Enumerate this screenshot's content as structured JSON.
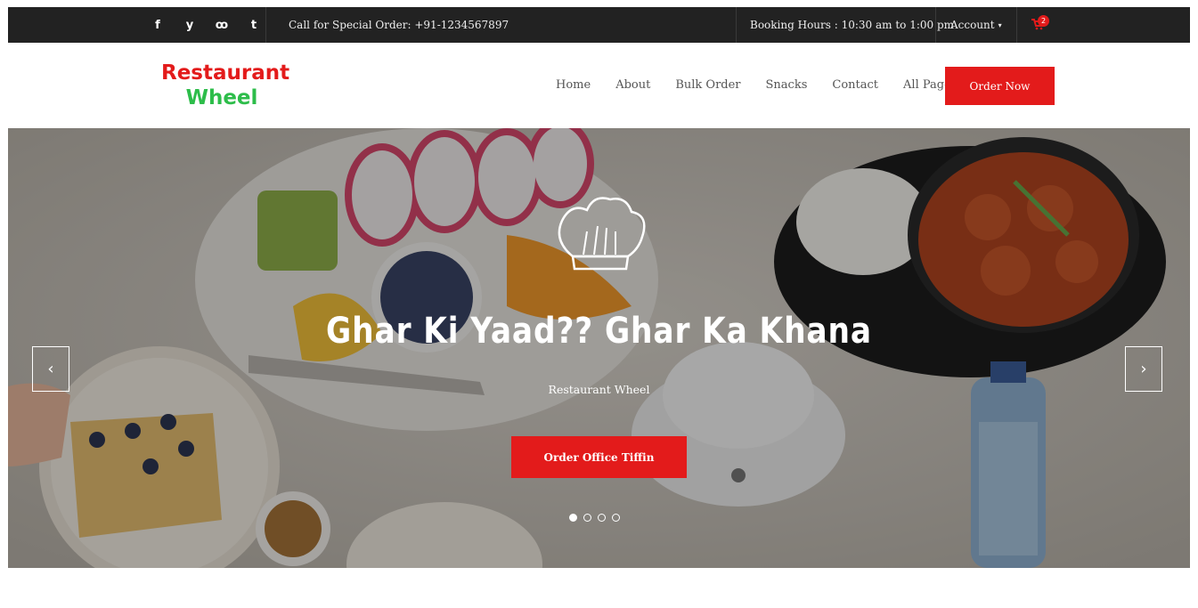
{
  "topbar": {
    "social": [
      {
        "icon": "facebook-icon",
        "glyph": "f"
      },
      {
        "icon": "twitter-icon",
        "glyph": "y"
      },
      {
        "icon": "tripadvisor-icon",
        "glyph": "ꝏ"
      },
      {
        "icon": "tumblr-icon",
        "glyph": "t"
      }
    ],
    "call_text": "Call for Special Order: +91-1234567897",
    "booking_text": "Booking Hours : 10:30 am to 1:00 pm",
    "account_label": "Account",
    "cart_count": "2"
  },
  "header": {
    "logo_line1": "Restaurant",
    "logo_line2": "Wheel",
    "nav": [
      "Home",
      "About",
      "Bulk Order",
      "Snacks",
      "Contact",
      "All Pages"
    ],
    "order_button": "Order Now"
  },
  "hero": {
    "title": "Ghar Ki Yaad?? Ghar Ka Khana",
    "subtitle": "Restaurant Wheel",
    "button": "Order Office Tiffin",
    "prev": "‹",
    "next": "›",
    "slides_total": 4,
    "active_slide": 1
  },
  "colors": {
    "accent": "#e31b1b",
    "logo_green": "#2dbd4a",
    "topbar_bg": "#222222"
  }
}
